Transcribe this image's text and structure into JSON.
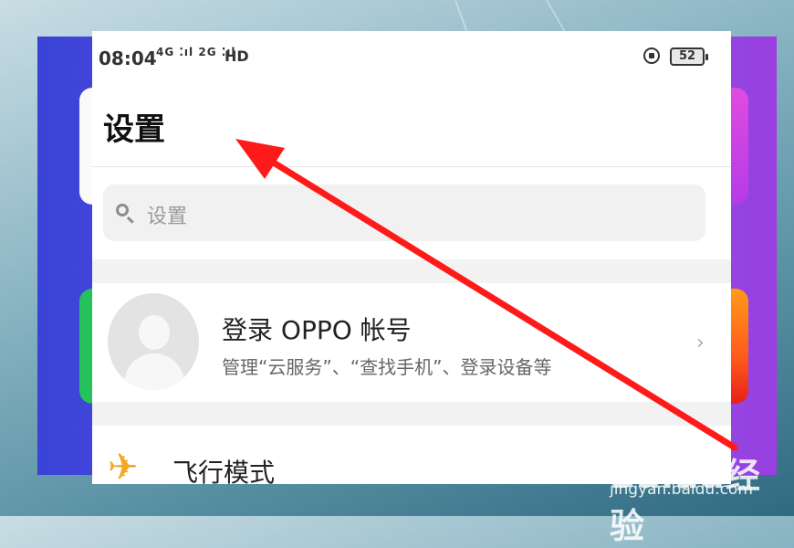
{
  "status_bar": {
    "time": "08:04",
    "signal_text": "4G ⁚ıl 2G ⁚ıl",
    "hd_text": "HD",
    "battery": "52"
  },
  "page": {
    "title": "设置"
  },
  "search": {
    "placeholder": "设置"
  },
  "account": {
    "title": "登录 OPPO 帐号",
    "subtitle": "管理“云服务”、“查找手机”、登录设备等"
  },
  "settings_items": [
    {
      "label": "飞行模式",
      "icon": "airplane-icon"
    }
  ],
  "watermark": {
    "brand": "Baidu经验",
    "url": "jingyan.baidu.com"
  },
  "colors": {
    "arrow": "#ff1a1a",
    "airplane_icon": "#f5a623",
    "purple_band": "#5a4fe0"
  }
}
